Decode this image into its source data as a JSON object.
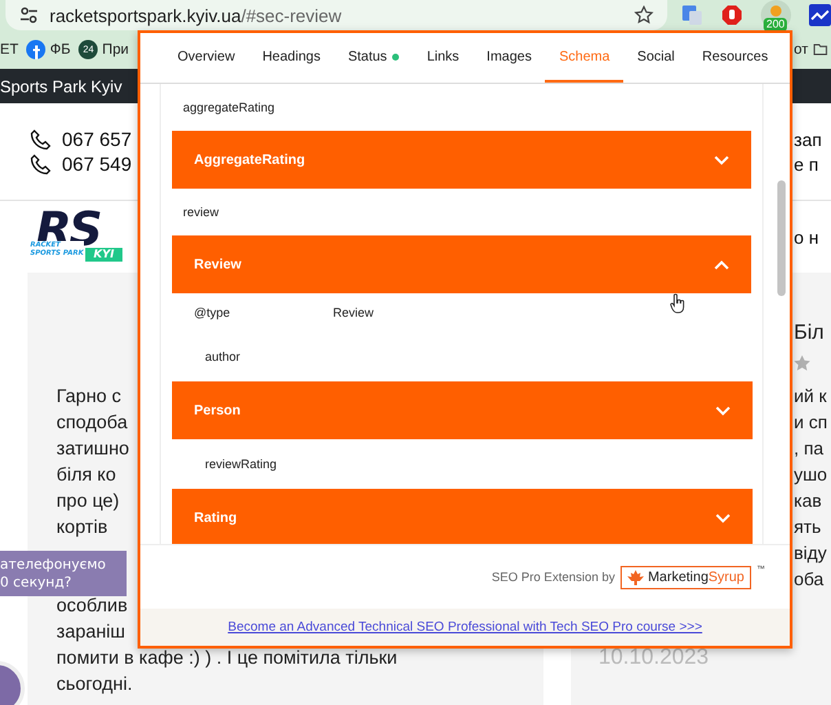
{
  "browser": {
    "url_host": "racketsportspark.kyiv.ua",
    "url_path": "/#sec-review",
    "extension_badge": "200"
  },
  "bookmarks": {
    "left": [
      {
        "kind": "text",
        "label": "ЕТ"
      },
      {
        "kind": "icon",
        "label": "ФБ"
      },
      {
        "kind": "badge",
        "badge": "24",
        "label": "При"
      }
    ],
    "right": "от"
  },
  "site_bar": {
    "title": "Sports Park Kyiv"
  },
  "header": {
    "phones": [
      "067 657",
      "067 549"
    ],
    "right_fragments": [
      "зап",
      "е п"
    ],
    "logo": {
      "letters": "RS",
      "small_1": "RACKET",
      "small_2": "SPORTS PARK",
      "band": "KYI"
    },
    "logo_right": "о н"
  },
  "review": {
    "heading_fragment": "Біл",
    "lines": [
      {
        "left": "Гарно с",
        "right": "ий к"
      },
      {
        "left": "сподоба",
        "right": "и сп"
      },
      {
        "left": "затишно",
        "right": ", па"
      },
      {
        "left": "біля ко",
        "right": "ушо"
      },
      {
        "left": "про це)",
        "right": "кав"
      },
      {
        "left": "кортів",
        "right": "ять"
      },
      {
        "right": "віду"
      },
      {
        "right": "оба"
      },
      {
        "left": "особлив"
      },
      {
        "left": "заранiш"
      },
      {
        "left": "помити в кафе :) ) . І це помітила тільки",
        "date": "10.10.2023"
      },
      {
        "left": "сьогодні."
      }
    ]
  },
  "callback": [
    "ателефонуємо",
    "0 секунд?"
  ],
  "popup": {
    "tabs": [
      {
        "label": "Overview",
        "selected": false,
        "indicator": false
      },
      {
        "label": "Headings",
        "selected": false,
        "indicator": false
      },
      {
        "label": "Status",
        "selected": false,
        "indicator": true
      },
      {
        "label": "Links",
        "selected": false,
        "indicator": false
      },
      {
        "label": "Images",
        "selected": false,
        "indicator": false
      },
      {
        "label": "Schema",
        "selected": true,
        "indicator": false
      },
      {
        "label": "Social",
        "selected": false,
        "indicator": false
      },
      {
        "label": "Resources",
        "selected": false,
        "indicator": false
      }
    ],
    "schema": [
      {
        "name": "aggregateRating",
        "type": "AggregateRating",
        "expanded": false
      },
      {
        "name": "review",
        "type": "Review",
        "expanded": true,
        "children": [
          {
            "kind": "property",
            "name": "@type",
            "value": "Review"
          },
          {
            "kind": "object",
            "name": "author",
            "type": "Person",
            "expanded": false
          },
          {
            "kind": "object",
            "name": "reviewRating",
            "type": "Rating",
            "expanded": false
          }
        ]
      }
    ],
    "footer": {
      "credit": "SEO Pro Extension by",
      "brand_1": "Marketing",
      "brand_2": "Syrup",
      "tm": "™"
    },
    "promo_link": "Become an Advanced Technical SEO Professional with Tech SEO Pro course >>>"
  }
}
